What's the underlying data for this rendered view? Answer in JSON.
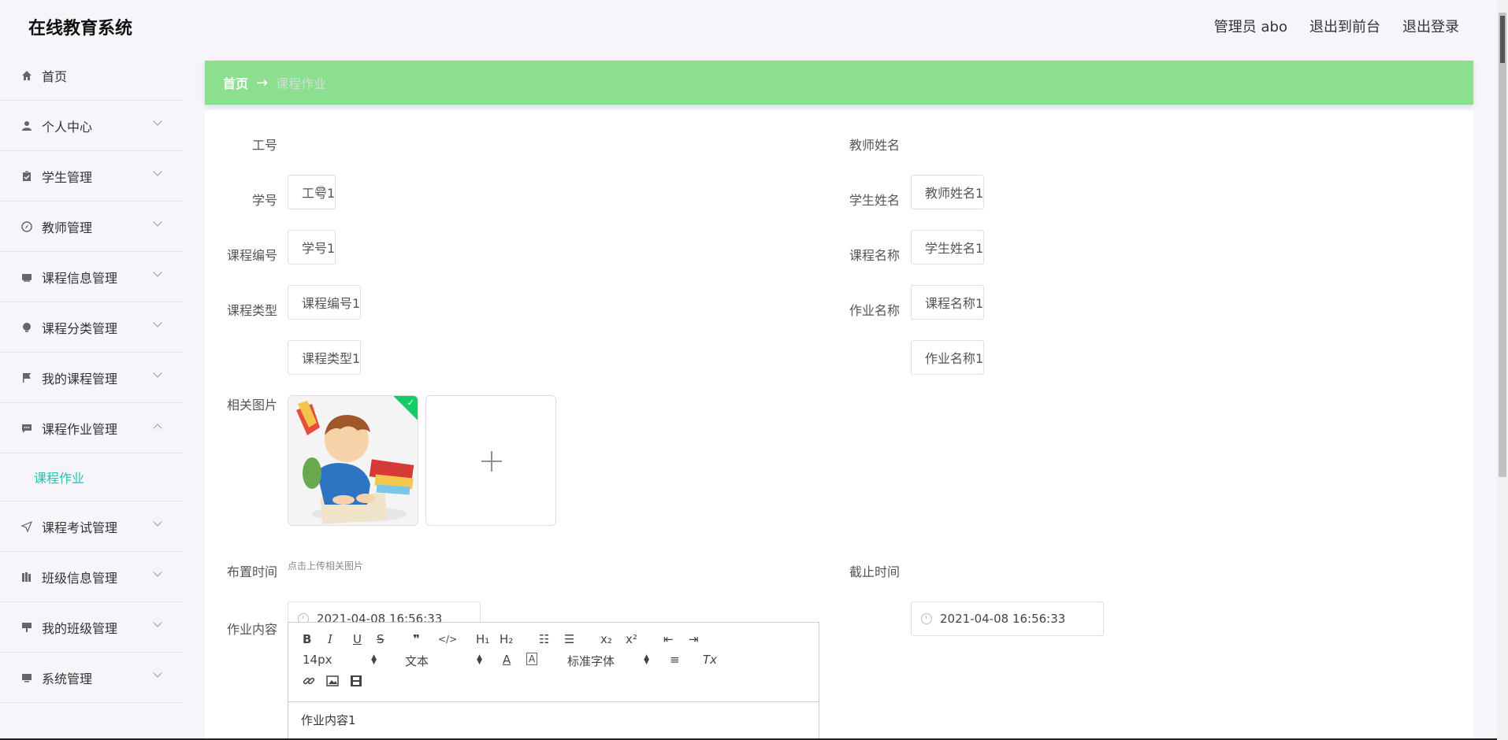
{
  "header": {
    "brand": "在线教育系统",
    "user": "管理员 abo",
    "to_front": "退出到前台",
    "logout": "退出登录"
  },
  "sidebar": {
    "items": [
      {
        "label": "首页",
        "icon": "home-icon"
      },
      {
        "label": "个人中心",
        "icon": "user-icon"
      },
      {
        "label": "学生管理",
        "icon": "clipboard-icon"
      },
      {
        "label": "教师管理",
        "icon": "compass-icon"
      },
      {
        "label": "课程信息管理",
        "icon": "inbox-icon"
      },
      {
        "label": "课程分类管理",
        "icon": "bulb-icon"
      },
      {
        "label": "我的课程管理",
        "icon": "flag-icon"
      },
      {
        "label": "课程作业管理",
        "icon": "chat-icon"
      },
      {
        "label": "课程考试管理",
        "icon": "send-icon"
      },
      {
        "label": "班级信息管理",
        "icon": "books-icon"
      },
      {
        "label": "我的班级管理",
        "icon": "sign-icon"
      },
      {
        "label": "系统管理",
        "icon": "monitor-icon"
      }
    ],
    "subitem": "课程作业"
  },
  "breadcrumb": {
    "home": "首页",
    "arrow": "→",
    "current": "课程作业"
  },
  "form": {
    "teacher_no_label": "工号",
    "teacher_no_value": "工号1",
    "teacher_name_label": "教师姓名",
    "teacher_name_value": "教师姓名1",
    "student_no_label": "学号",
    "student_no_value": "学号1",
    "student_name_label": "学生姓名",
    "student_name_value": "学生姓名1",
    "course_no_label": "课程编号",
    "course_no_value": "课程编号1",
    "course_name_label": "课程名称",
    "course_name_value": "课程名称1",
    "course_type_label": "课程类型",
    "course_type_value": "课程类型1",
    "homework_name_label": "作业名称",
    "homework_name_value": "作业名称1",
    "image_label": "相关图片",
    "image_hint": "点击上传相关图片",
    "assign_time_label": "布置时间",
    "assign_time_value": "2021-04-08 16:56:33",
    "deadline_label": "截止时间",
    "deadline_value": "2021-04-08 16:56:33",
    "content_label": "作业内容",
    "content_value": "作业内容1"
  },
  "editor": {
    "bold": "B",
    "italic": "I",
    "underline": "U",
    "strike": "S",
    "quote": "❞",
    "code": "</>",
    "h1": "H₁",
    "h2": "H₂",
    "ol": "☷",
    "ul": "☰",
    "sub": "x₂",
    "sup": "x²",
    "outdent": "⇤",
    "indent": "⇥",
    "size": "14px",
    "format": "文本",
    "color": "A",
    "bg": "A",
    "font": "标准字体",
    "align": "≡",
    "clear": "Tx",
    "link": "🔗",
    "image": "▣",
    "video": "▤"
  },
  "colors": {
    "breadcrumb_bg": "#8bdf8f",
    "active_sub": "#2dbfb0"
  }
}
